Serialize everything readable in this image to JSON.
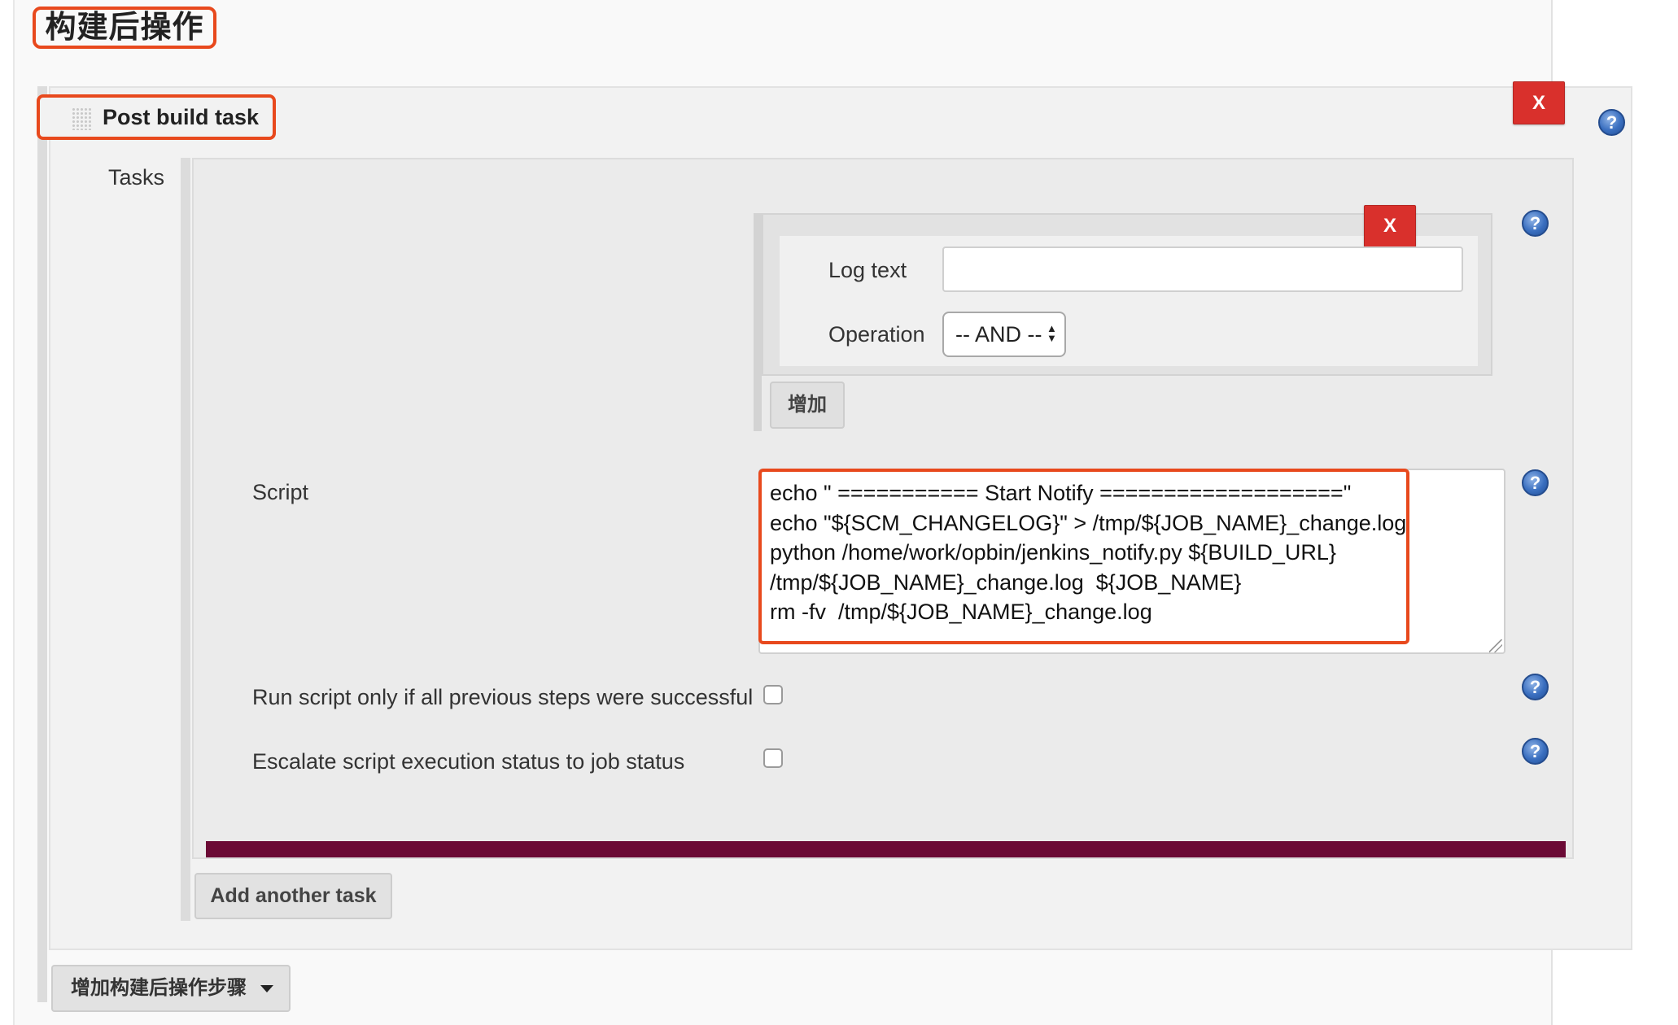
{
  "section_title": "构建后操作",
  "post_build_task": {
    "title": "Post build task",
    "delete_label": "X",
    "help_label": "?",
    "tasks_label": "Tasks",
    "log_text": {
      "label": "Log text",
      "value": "",
      "delete_label": "X",
      "help_label": "?"
    },
    "operation": {
      "label": "Operation",
      "selected": "-- AND --",
      "arrows": "▲▼"
    },
    "add_button": "增加",
    "script": {
      "label": "Script",
      "help_label": "?",
      "lines": [
        "echo \" =========== Start Notify ===================\"",
        "echo \"${SCM_CHANGELOG}\" > /tmp/${JOB_NAME}_change.log",
        "python /home/work/opbin/jenkins_notify.py ${BUILD_URL}",
        "/tmp/${JOB_NAME}_change.log  ${JOB_NAME}",
        "rm -fv  /tmp/${JOB_NAME}_change.log"
      ]
    },
    "run_only_if_successful": {
      "label": "Run script only if all previous steps were successful",
      "checked": false,
      "help_label": "?"
    },
    "escalate_status": {
      "label": "Escalate script execution status to job status",
      "checked": false,
      "help_label": "?"
    },
    "add_another_task": "Add another task"
  },
  "add_post_build_step": "增加构建后操作步骤",
  "colors": {
    "highlight": "#e8491d",
    "delete_button": "#d9302c",
    "divider_bar": "#6b0a35",
    "help_icon": "#3a6fc0"
  },
  "icons": {
    "drag_handle": "grip-icon",
    "help": "help-icon",
    "dropdown": "caret-down-icon"
  }
}
